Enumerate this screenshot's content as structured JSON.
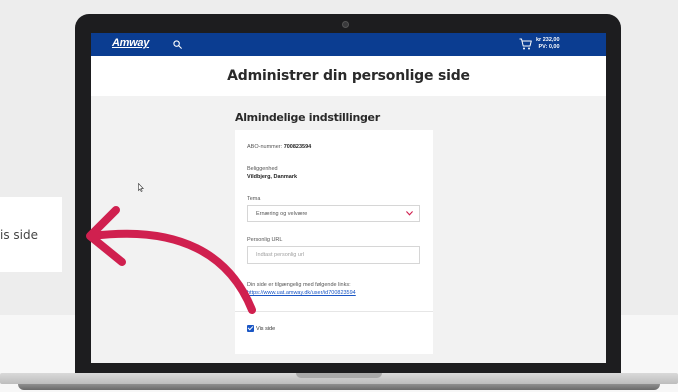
{
  "left_card": {
    "label": "is side"
  },
  "site": {
    "logo": "Amway",
    "cart": {
      "price": "kr 232,00",
      "pv": "PV: 0,00"
    },
    "accent_color": "#0b3d91"
  },
  "page": {
    "title": "Administrer din personlige side"
  },
  "settings": {
    "heading": "Almindelige indstillinger",
    "abo_label": "ABO-nummer:",
    "abo_value": "700823594",
    "location_label": "Beliggenhed",
    "location_value": "Vildbjerg, Danmark",
    "theme_label": "Tema",
    "theme_value": "Ernæring og velvære",
    "url_label": "Personlig URL",
    "url_placeholder": "Indtast personlig url",
    "links_text": "Din side er tilgængelig med følgende links:",
    "links_url": "https://www.uat.amway.dk/user/id700823594",
    "show_label": "Vis side",
    "show_checked": true
  },
  "annotation": {
    "arrow_color": "#d0204f"
  },
  "icons": [
    "search-icon",
    "cart-icon",
    "chevron-down-icon",
    "cursor-icon",
    "curved-arrow-icon",
    "camera-icon"
  ]
}
